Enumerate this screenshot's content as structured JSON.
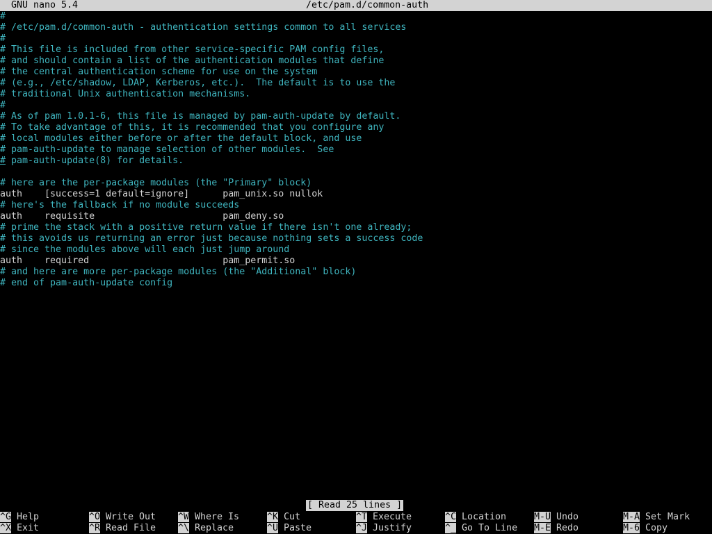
{
  "title_bar": {
    "app": "GNU nano 5.4",
    "file": "/etc/pam.d/common-auth"
  },
  "editor": {
    "lines": [
      {
        "text": "#",
        "type": "comment"
      },
      {
        "text": "# /etc/pam.d/common-auth - authentication settings common to all services",
        "type": "comment"
      },
      {
        "text": "#",
        "type": "comment"
      },
      {
        "text": "# This file is included from other service-specific PAM config files,",
        "type": "comment"
      },
      {
        "text": "# and should contain a list of the authentication modules that define",
        "type": "comment"
      },
      {
        "text": "# the central authentication scheme for use on the system",
        "type": "comment"
      },
      {
        "text": "# (e.g., /etc/shadow, LDAP, Kerberos, etc.).  The default is to use the",
        "type": "comment"
      },
      {
        "text": "# traditional Unix authentication mechanisms.",
        "type": "comment"
      },
      {
        "text": "#",
        "type": "comment"
      },
      {
        "text": "# As of pam 1.0.1-6, this file is managed by pam-auth-update by default.",
        "type": "comment"
      },
      {
        "text": "# To take advantage of this, it is recommended that you configure any",
        "type": "comment"
      },
      {
        "text": "# local modules either before or after the default block, and use",
        "type": "comment"
      },
      {
        "text": "# pam-auth-update to manage selection of other modules.  See",
        "type": "comment"
      },
      {
        "text": "# pam-auth-update(8) for details.",
        "type": "comment-cursor"
      },
      {
        "text": "",
        "type": "blank"
      },
      {
        "text": "# here are the per-package modules (the \"Primary\" block)",
        "type": "comment"
      },
      {
        "text": "auth    [success=1 default=ignore]      pam_unix.so nullok",
        "type": "code"
      },
      {
        "text": "# here's the fallback if no module succeeds",
        "type": "comment"
      },
      {
        "text": "auth    requisite                       pam_deny.so",
        "type": "code"
      },
      {
        "text": "# prime the stack with a positive return value if there isn't one already;",
        "type": "comment"
      },
      {
        "text": "# this avoids us returning an error just because nothing sets a success code",
        "type": "comment"
      },
      {
        "text": "# since the modules above will each just jump around",
        "type": "comment"
      },
      {
        "text": "auth    required                        pam_permit.so",
        "type": "code"
      },
      {
        "text": "# and here are more per-package modules (the \"Additional\" block)",
        "type": "comment"
      },
      {
        "text": "# end of pam-auth-update config",
        "type": "comment"
      }
    ]
  },
  "status_message": "[ Read 25 lines ]",
  "shortcuts": [
    {
      "key": "^G",
      "label": "Help"
    },
    {
      "key": "^X",
      "label": "Exit"
    },
    {
      "key": "^O",
      "label": "Write Out"
    },
    {
      "key": "^R",
      "label": "Read File"
    },
    {
      "key": "^W",
      "label": "Where Is"
    },
    {
      "key": "^\\",
      "label": "Replace"
    },
    {
      "key": "^K",
      "label": "Cut"
    },
    {
      "key": "^U",
      "label": "Paste"
    },
    {
      "key": "^T",
      "label": "Execute"
    },
    {
      "key": "^J",
      "label": "Justify"
    },
    {
      "key": "^C",
      "label": "Location"
    },
    {
      "key": "^_",
      "label": "Go To Line"
    },
    {
      "key": "M-U",
      "label": "Undo"
    },
    {
      "key": "M-E",
      "label": "Redo"
    },
    {
      "key": "M-A",
      "label": "Set Mark"
    },
    {
      "key": "M-6",
      "label": "Copy"
    }
  ],
  "colors": {
    "background": "#000000",
    "comment": "#3fb5bf",
    "code": "#d3d3d3",
    "bar": "#d3d3d3"
  }
}
